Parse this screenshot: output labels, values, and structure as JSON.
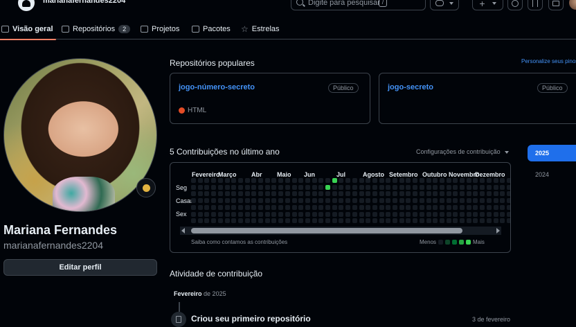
{
  "header": {
    "username": "marianafernandes2204",
    "search_placeholder": "Digite para pesquisar",
    "search_shortcut": "/",
    "new_label": "+"
  },
  "tabs": [
    {
      "label": "Visão geral",
      "active": true,
      "icon": "book-icon"
    },
    {
      "label": "Repositórios",
      "count": "2",
      "icon": "repo-icon"
    },
    {
      "label": "Projetos",
      "icon": "table-icon"
    },
    {
      "label": "Pacotes",
      "icon": "package-icon"
    },
    {
      "label": "Estrelas",
      "icon": "star-icon"
    }
  ],
  "profile": {
    "full_name": "Mariana Fernandes",
    "login": "marianafernandes2204",
    "edit_button": "Editar perfil"
  },
  "popular": {
    "title": "Repositórios populares",
    "customize": "Personalize seus pinos",
    "repos": [
      {
        "name": "jogo-número-secreto",
        "visibility": "Público",
        "language": "HTML",
        "language_color": "#e34c26"
      },
      {
        "name": "jogo-secreto",
        "visibility": "Público"
      }
    ]
  },
  "contributions": {
    "title": "5 Contribuições no último ano",
    "settings": "Configurações de contribuição",
    "months": [
      "Fevereiro",
      "Março",
      "Abr",
      "Maio",
      "Jun",
      "Jul",
      "Agosto",
      "Setembro",
      "Outubro",
      "Novembro",
      "Dezembro"
    ],
    "days": [
      "Seg",
      "Casar",
      "Sex"
    ],
    "learn_text": "Saiba como contamos as contribuições",
    "legend_less": "Menos",
    "legend_more": "Mais",
    "legend_colors": [
      "#151b23",
      "#0e4429",
      "#006d32",
      "#26a641",
      "#39d353"
    ],
    "active_color": "#39d353"
  },
  "years": [
    {
      "label": "2025",
      "active": true
    },
    {
      "label": "2024",
      "active": false
    }
  ],
  "activity": {
    "title": "Atividade de contribuição",
    "month_label": "Fevereiro",
    "month_year": "de 2025",
    "event_title": "Criou seu primeiro repositório",
    "event_date": "3 de fevereiro"
  }
}
